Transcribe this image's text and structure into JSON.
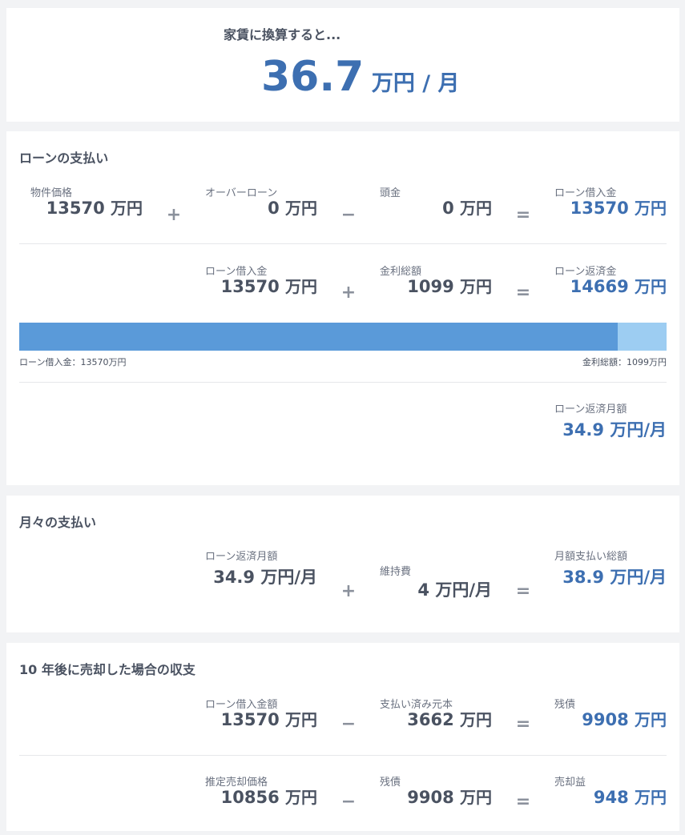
{
  "header": {
    "caption": "家賃に換算すると...",
    "value": "36.7",
    "unit": "万円 / 月"
  },
  "loan": {
    "title": "ローンの支払い",
    "row1": {
      "property_label": "物件価格",
      "property_value": "13570",
      "over_label": "オーバーローン",
      "over_value": "0",
      "down_label": "頭金",
      "down_value": "0",
      "loan_label": "ローン借入金",
      "loan_value": "13570",
      "op1": "+",
      "op2": "−",
      "op3": "="
    },
    "row2": {
      "loan_label": "ローン借入金",
      "loan_value": "13570",
      "interest_label": "金利総額",
      "interest_value": "1099",
      "repay_label": "ローン返済金",
      "repay_value": "14669",
      "op1": "+",
      "op2": "="
    },
    "bar": {
      "principal": 13570,
      "interest": 1099,
      "left_caption": "ローン借入金：13570万円",
      "right_caption": "金利総額：1099万円"
    },
    "monthly_label": "ローン返済月額",
    "monthly_value": "34.9 万円/月"
  },
  "monthly": {
    "title": "月々の支払い",
    "repay_label": "ローン返済月額",
    "repay_value": "34.9 万円/月",
    "maint_label": "維持費",
    "maint_value": "4 万円/月",
    "total_label": "月額支払い総額",
    "total_value": "38.9 万円/月",
    "op1": "+",
    "op2": "="
  },
  "sale": {
    "title": "10 年後に売却した場合の収支",
    "row1": {
      "loan_label": "ローン借入金額",
      "loan_value": "13570",
      "paid_label": "支払い済み元本",
      "paid_value": "3662",
      "remain_label": "残債",
      "remain_value": "9908",
      "op1": "−",
      "op2": "="
    },
    "row2": {
      "est_label": "推定売却価格",
      "est_value": "10856",
      "remain_label": "残債",
      "remain_value": "9908",
      "profit_label": "売却益",
      "profit_value": "948",
      "op1": "−",
      "op2": "="
    }
  },
  "unit": "万円",
  "colors": {
    "accent": "#3d6fb1",
    "bar_principal": "#5a9ad9",
    "bar_interest": "#9dcdf2"
  }
}
